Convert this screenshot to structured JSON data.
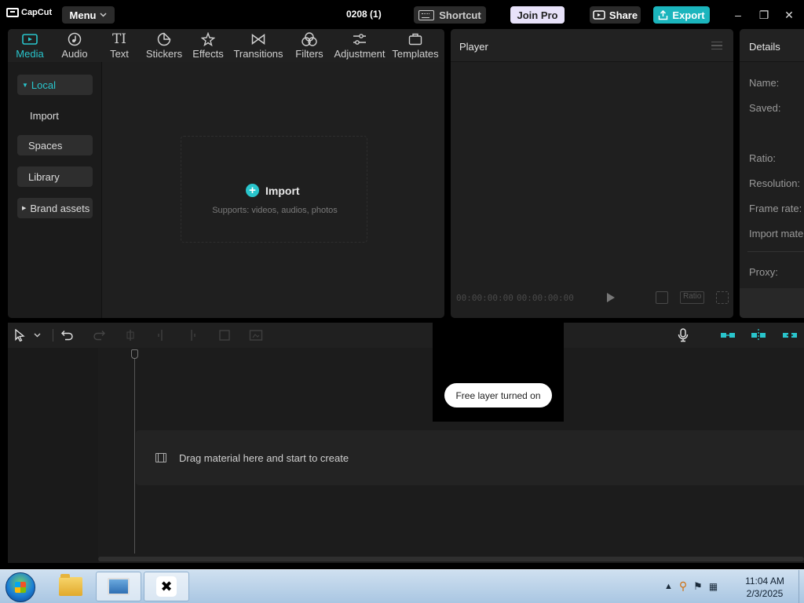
{
  "titlebar": {
    "app_name": "CapCut",
    "menu_label": "Menu",
    "project_title": "0208 (1)",
    "shortcut_label": "Shortcut",
    "joinpro_label": "Join Pro",
    "share_label": "Share",
    "export_label": "Export"
  },
  "media_tabs": [
    {
      "label": "Media",
      "icon": "media-icon",
      "active": true
    },
    {
      "label": "Audio",
      "icon": "audio-icon"
    },
    {
      "label": "Text",
      "icon": "text-icon"
    },
    {
      "label": "Stickers",
      "icon": "stickers-icon"
    },
    {
      "label": "Effects",
      "icon": "effects-icon"
    },
    {
      "label": "Transitions",
      "icon": "transitions-icon"
    },
    {
      "label": "Filters",
      "icon": "filters-icon"
    },
    {
      "label": "Adjustment",
      "icon": "adjustment-icon"
    },
    {
      "label": "Templates",
      "icon": "templates-icon"
    }
  ],
  "sidebar": {
    "items": [
      {
        "label": "Local"
      },
      {
        "label": "Import"
      },
      {
        "label": "Spaces"
      },
      {
        "label": "Library"
      },
      {
        "label": "Brand assets"
      }
    ]
  },
  "import_zone": {
    "label": "Import",
    "sub": "Supports: videos, audios, photos"
  },
  "player": {
    "title": "Player",
    "time_current": "00:00:00:00",
    "time_total": "00:00:00:00",
    "ratio_label": "Ratio"
  },
  "details": {
    "title": "Details",
    "labels": [
      "Name:",
      "Saved:",
      "Ratio:",
      "Resolution:",
      "Frame rate:",
      "Import mate",
      "Proxy:"
    ]
  },
  "timeline": {
    "drop_hint": "Drag material here and start to create"
  },
  "toast": {
    "text": "Free layer turned on"
  },
  "taskbar": {
    "time": "11:04 AM",
    "date": "2/3/2025"
  },
  "colors": {
    "accent": "#29c5cc",
    "export": "#1bb5bd",
    "joinpro": "#e8e2fa"
  }
}
